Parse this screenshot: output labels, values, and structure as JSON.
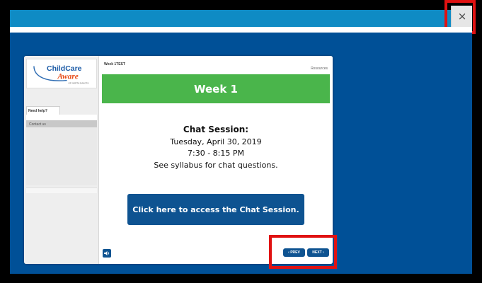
{
  "window": {
    "close_glyph": "×"
  },
  "colors": {
    "topbar": "#0f8bc4",
    "background": "#005097",
    "banner_green": "#4ab54b",
    "button_blue": "#0e5391",
    "highlight_red": "#e01212"
  },
  "sidebar": {
    "logo": {
      "line1": "ChildCare",
      "line2": "Aware",
      "line3": "OF NORTH DAKOTA"
    },
    "help_tab_label": "Need help?",
    "contact_label": "Contact us"
  },
  "content": {
    "course_title": "Week 1TEST",
    "resources_label": "Resources",
    "banner_title": "Week 1",
    "chat_title": "Chat Session:",
    "chat_date": "Tuesday, April 30, 2019",
    "chat_time": "7:30 - 8:15 PM",
    "chat_note": "See syllabus for chat questions.",
    "cta_label": "Click here to access the Chat Session."
  },
  "controls": {
    "prev_label": "‹ PREV",
    "next_label": "NEXT ›",
    "volume_icon": "speaker-icon"
  }
}
